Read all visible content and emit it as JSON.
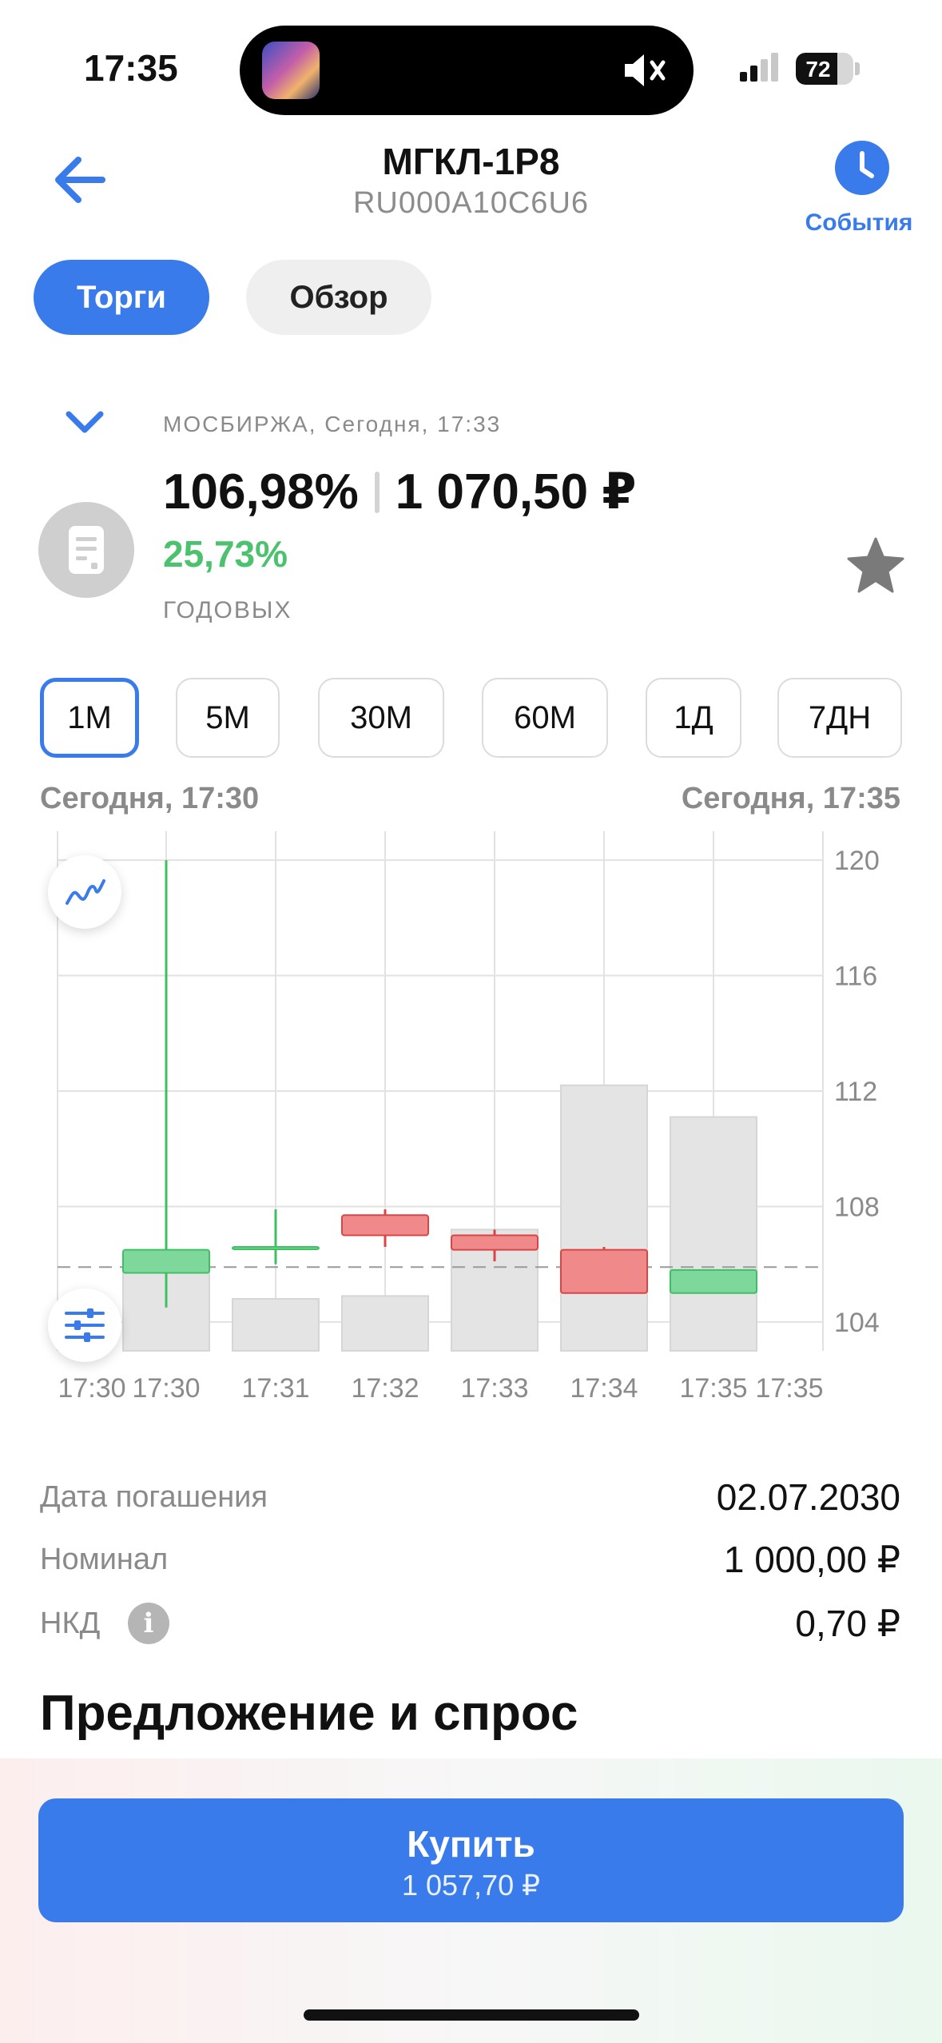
{
  "status": {
    "time": "17:35",
    "battery": "72",
    "battery_level": 0.72
  },
  "header": {
    "title": "МГКЛ-1P8",
    "isin": "RU000A10C6U6",
    "events_label": "События"
  },
  "tabs": [
    {
      "label": "Торги",
      "active": true
    },
    {
      "label": "Обзор",
      "active": false
    }
  ],
  "quote": {
    "exchange_line": "МОСБИРЖА, Сегодня, 17:33",
    "price_percent": "106,98%",
    "price_rub": "1 070,50 ₽",
    "yield": "25,73%",
    "yield_label": "ГОДОВЫХ"
  },
  "intervals": [
    {
      "label": "1М",
      "active": true
    },
    {
      "label": "5М",
      "active": false
    },
    {
      "label": "30М",
      "active": false
    },
    {
      "label": "60М",
      "active": false
    },
    {
      "label": "1Д",
      "active": false
    },
    {
      "label": "7ДН",
      "active": false
    }
  ],
  "range": {
    "from": "Сегодня, 17:30",
    "to": "Сегодня, 17:35"
  },
  "chart_data": {
    "type": "candlestick",
    "ylim": [
      103,
      121
    ],
    "yticks": [
      "120",
      "116",
      "112",
      "108",
      "104"
    ],
    "ytick_values": [
      120,
      116,
      112,
      108,
      104
    ],
    "xticks": [
      "17:30",
      "17:30",
      "17:31",
      "17:32",
      "17:33",
      "17:34",
      "17:35",
      "17:35"
    ],
    "reference_line": 105.9,
    "candles": [
      {
        "time": "17:30",
        "open": 105.7,
        "high": 120.0,
        "low": 104.5,
        "close": 106.5,
        "volume_top": 106.4
      },
      {
        "time": "17:31",
        "open": 106.6,
        "high": 107.9,
        "low": 106.0,
        "close": 106.6,
        "volume_top": 104.8
      },
      {
        "time": "17:32",
        "open": 107.7,
        "high": 107.9,
        "low": 106.6,
        "close": 107.0,
        "volume_top": 104.9
      },
      {
        "time": "17:33",
        "open": 107.0,
        "high": 107.2,
        "low": 106.1,
        "close": 106.5,
        "volume_top": 107.2
      },
      {
        "time": "17:34",
        "open": 106.5,
        "high": 106.6,
        "low": 105.0,
        "close": 105.0,
        "volume_top": 112.2
      },
      {
        "time": "17:35",
        "open": 105.0,
        "high": 105.8,
        "low": 105.0,
        "close": 105.8,
        "volume_top": 111.1
      }
    ],
    "colors": {
      "up": "#7fd89b",
      "down": "#f08a8a",
      "up_stroke": "#3fbf63",
      "down_stroke": "#d94545",
      "volume": "#e4e4e4"
    }
  },
  "info": {
    "maturity_label": "Дата погашения",
    "maturity_value": "02.07.2030",
    "nominal_label": "Номинал",
    "nominal_value": "1 000,00 ₽",
    "nkd_label": "НКД",
    "nkd_value": "0,70 ₽",
    "info_icon_glyph": "i"
  },
  "orderbook_title": "Предложение и спрос",
  "buy": {
    "label": "Купить",
    "price": "1 057,70 ₽"
  },
  "colors": {
    "accent": "#3a7bec",
    "positive": "#4dc26e"
  }
}
